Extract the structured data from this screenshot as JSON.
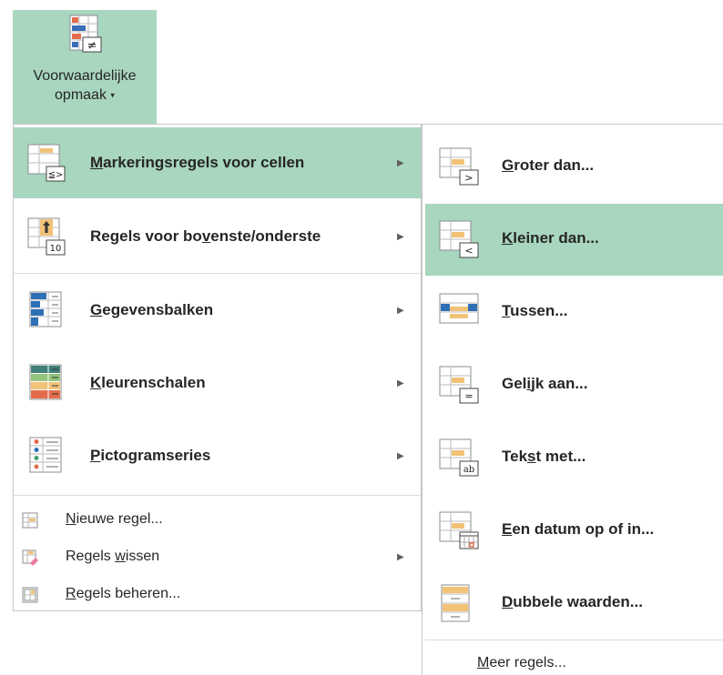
{
  "ribbon": {
    "button_line1": "Voorwaardelijke",
    "button_line2": "opmaak",
    "caret": "▾"
  },
  "menu": {
    "items": [
      {
        "pre": "",
        "acc": "M",
        "post": "arkeringsregels voor cellen",
        "icon": "highlight-rules-icon",
        "active": true
      },
      {
        "pre": "Regels voor bo",
        "acc": "v",
        "post": "enste/onderste",
        "icon": "top-bottom-rules-icon",
        "active": false
      },
      {
        "pre": "",
        "acc": "G",
        "post": "egevensbalken",
        "icon": "data-bars-icon",
        "active": false
      },
      {
        "pre": "",
        "acc": "K",
        "post": "leurenschalen",
        "icon": "color-scales-icon",
        "active": false
      },
      {
        "pre": "",
        "acc": "P",
        "post": "ictogramseries",
        "icon": "icon-sets-icon",
        "active": false
      }
    ],
    "small_items": [
      {
        "pre": "",
        "acc": "N",
        "post": "ieuwe regel...",
        "icon": "new-rule-icon"
      },
      {
        "pre": "Regels ",
        "acc": "w",
        "post": "issen",
        "icon": "clear-rules-icon"
      },
      {
        "pre": "",
        "acc": "R",
        "post": "egels beheren...",
        "icon": "manage-rules-icon"
      }
    ],
    "arrow": "▶"
  },
  "submenu": {
    "items": [
      {
        "pre": "",
        "acc": "G",
        "post": "roter dan...",
        "icon": "greater-than-icon",
        "active": false
      },
      {
        "pre": "",
        "acc": "K",
        "post": "leiner dan...",
        "icon": "less-than-icon",
        "active": true
      },
      {
        "pre": "",
        "acc": "T",
        "post": "ussen...",
        "icon": "between-icon",
        "active": false
      },
      {
        "pre": "Gel",
        "acc": "i",
        "post": "jk aan...",
        "icon": "equal-to-icon",
        "active": false
      },
      {
        "pre": "Tek",
        "acc": "s",
        "post": "t met...",
        "icon": "text-contains-icon",
        "active": false
      },
      {
        "pre": "",
        "acc": "E",
        "post": "en datum op of in...",
        "icon": "date-occurring-icon",
        "active": false
      },
      {
        "pre": "",
        "acc": "D",
        "post": "ubbele waarden...",
        "icon": "duplicate-values-icon",
        "active": false
      }
    ],
    "more": {
      "pre": "",
      "acc": "M",
      "post": "eer regels..."
    }
  }
}
